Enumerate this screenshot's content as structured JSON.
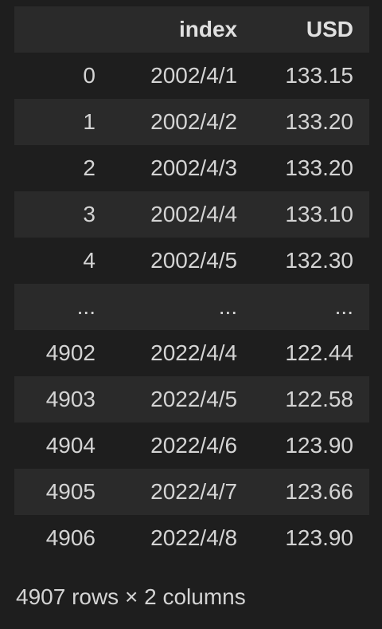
{
  "table": {
    "headers": [
      "",
      "index",
      "USD"
    ],
    "rows": [
      [
        "0",
        "2002/4/1",
        "133.15"
      ],
      [
        "1",
        "2002/4/2",
        "133.20"
      ],
      [
        "2",
        "2002/4/3",
        "133.20"
      ],
      [
        "3",
        "2002/4/4",
        "133.10"
      ],
      [
        "4",
        "2002/4/5",
        "132.30"
      ],
      [
        "...",
        "...",
        "..."
      ],
      [
        "4902",
        "2022/4/4",
        "122.44"
      ],
      [
        "4903",
        "2022/4/5",
        "122.58"
      ],
      [
        "4904",
        "2022/4/6",
        "123.90"
      ],
      [
        "4905",
        "2022/4/7",
        "123.66"
      ],
      [
        "4906",
        "2022/4/8",
        "123.90"
      ]
    ]
  },
  "footer": {
    "shape": "4907 rows × 2 columns"
  }
}
